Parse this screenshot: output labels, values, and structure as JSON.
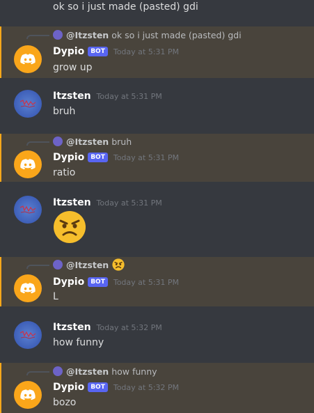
{
  "top": {
    "text": "ok so i just made (pasted) gdi"
  },
  "messages": [
    {
      "reply": {
        "name": "@Itzsten",
        "text": "ok so i just made (pasted) gdi"
      },
      "author": "Dypio",
      "tag": "BOT",
      "time": "Today at 5:31 PM",
      "text": "grow up"
    },
    {
      "author": "Itzsten",
      "time": "Today at 5:31 PM",
      "text": "bruh"
    },
    {
      "reply": {
        "name": "@Itzsten",
        "text": "bruh"
      },
      "author": "Dypio",
      "tag": "BOT",
      "time": "Today at 5:31 PM",
      "text": "ratio"
    },
    {
      "author": "Itzsten",
      "time": "Today at 5:31 PM",
      "emoji": "angry-face-emoji"
    },
    {
      "reply": {
        "name": "@Itzsten",
        "emoji": "angry-face-emoji"
      },
      "author": "Dypio",
      "tag": "BOT",
      "time": "Today at 5:31 PM",
      "text": "L"
    },
    {
      "author": "Itzsten",
      "time": "Today at 5:32 PM",
      "text": "how funny"
    },
    {
      "reply": {
        "name": "@Itzsten",
        "text": "how funny"
      },
      "author": "Dypio",
      "tag": "BOT",
      "time": "Today at 5:32 PM",
      "text": "bozo"
    }
  ],
  "colors": {
    "background": "#36393f",
    "mention_highlight": "#49443c",
    "mention_bar": "#faa81a",
    "bot_tag": "#5865f2",
    "bot_avatar": "#faa61a",
    "user_avatar": "#4a6fc4"
  }
}
